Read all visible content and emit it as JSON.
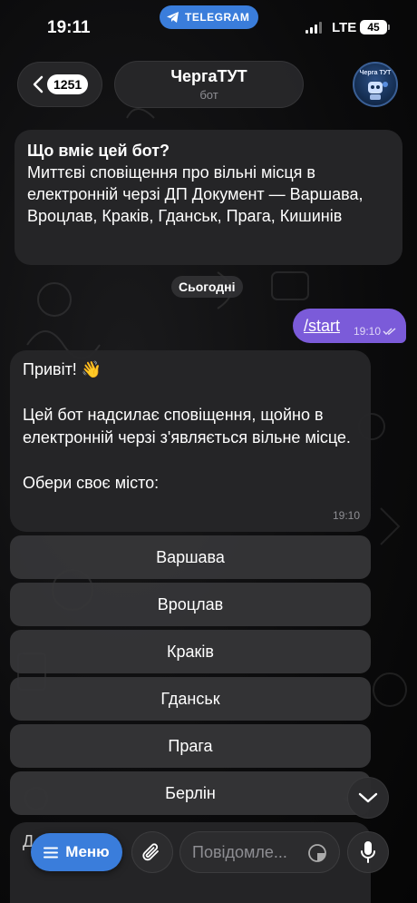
{
  "status_bar": {
    "time": "19:11",
    "app_pill": "TELEGRAM",
    "network": "LTE",
    "battery": "45"
  },
  "header": {
    "back_count": "1251",
    "chat_name": "ЧергаТУТ",
    "chat_subtitle": "бот",
    "avatar_text": "Черга ТУТ"
  },
  "info_message": {
    "title": "Що вміє цей бот?",
    "body": "Миттєві сповіщення про вільні місця в електронній черзі ДП Документ — Варшава, Вроцлав, Краків, Гданськ, Прага, Кишинів"
  },
  "date_chip": "Сьогодні",
  "outgoing": {
    "text": "/start",
    "time": "19:10"
  },
  "incoming": {
    "line1": "Привіт! 👋",
    "line2": "Цей бот надсилає сповіщення, щойно в електронній черзі з'являється вільне місце.",
    "line3": "Обери своє місто:",
    "time": "19:10"
  },
  "keyboard": [
    "Варшава",
    "Вроцлав",
    "Краків",
    "Гданськ",
    "Прага",
    "Берлін"
  ],
  "peek_text": "Д...",
  "composer": {
    "menu_label": "Меню",
    "placeholder": "Повідомле..."
  },
  "colors": {
    "accent": "#3a7ddb",
    "outgoing_bubble": "#7b5bd9"
  }
}
